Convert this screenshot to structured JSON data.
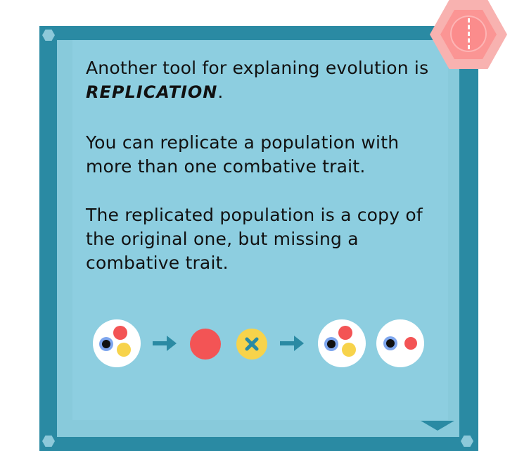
{
  "intro": {
    "line1": "Another tool for explaning evolution is",
    "keyword": "REPLICATION",
    "period": "."
  },
  "para2": {
    "line1": "You can replicate a population with",
    "line2": "more than one combative trait."
  },
  "para3": {
    "line1": "The replicated population is a copy of",
    "line2": "the original one, but missing a",
    "line3": "combative trait."
  },
  "colors": {
    "panel_border": "#2a8aa3",
    "panel_fill": "#88cadb",
    "trait_red": "#f35455",
    "trait_yellow": "#f7d34b",
    "trait_black": "#111111",
    "trait_ring_blue": "#7ea6ee",
    "badge_pink": "#f8b2b0"
  },
  "icons": {
    "badge": "hexagon-badge-icon",
    "next": "down-arrow-icon",
    "remove": "x-icon",
    "arrow": "right-arrow-icon"
  }
}
